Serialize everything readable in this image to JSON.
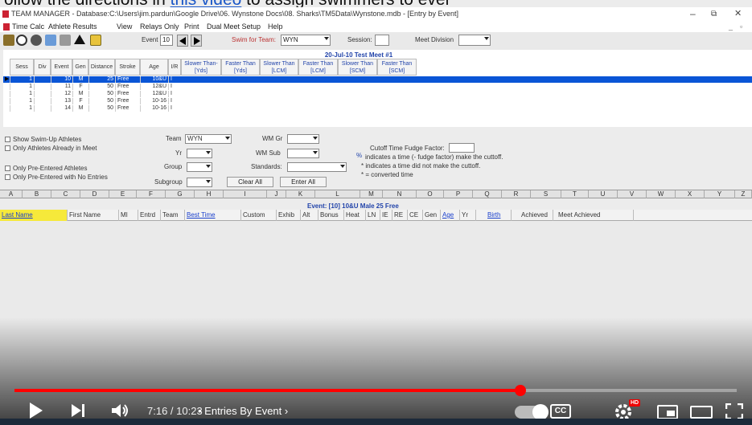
{
  "caption": {
    "before": "ollow the directions in ",
    "link": "this video",
    "after": " to assign swimmers to ever"
  },
  "window": {
    "title": "TEAM MANAGER - Database:C:\\Users\\jim.pardun\\Google Drive\\06. Wynstone Docs\\08. Sharks\\TM5Data\\Wynstone.mdb - [Entry by Event]",
    "minimize": "–",
    "restore": "⧉",
    "close": "✕"
  },
  "menu": [
    "Time Calc",
    "Athlete Results",
    "View",
    "Relays Only",
    "Print",
    "Dual Meet Setup",
    "Help"
  ],
  "toolbar": {
    "event_label": "Event",
    "event_value": "10",
    "swim_for_team_label": "Swim for Team:",
    "swim_for_team_value": "WYN",
    "session_label": "Session:",
    "session_value": "",
    "meet_division_label": "Meet Division",
    "meet_division_value": ""
  },
  "meet_banner": "20-Jul-10  Test Meet #1",
  "event_grid": {
    "headers": [
      "Sess",
      "Div",
      "Event",
      "Gen",
      "Distance",
      "Stroke",
      "Age",
      "I/R",
      "Slower Than-[Yds]",
      "Faster Than [Yds]",
      "Slower Than [LCM]",
      "Faster Than [LCM]",
      "Slower Than [SCM]",
      "Faster Than [SCM]"
    ],
    "rows": [
      {
        "sess": "1",
        "div": "",
        "event": "10",
        "gen": "M",
        "distance": "25",
        "stroke": "Free",
        "age": "10&U",
        "ir": "I"
      },
      {
        "sess": "1",
        "div": "",
        "event": "11",
        "gen": "F",
        "distance": "50",
        "stroke": "Free",
        "age": "12&U",
        "ir": "I"
      },
      {
        "sess": "1",
        "div": "",
        "event": "12",
        "gen": "M",
        "distance": "50",
        "stroke": "Free",
        "age": "12&U",
        "ir": "I"
      },
      {
        "sess": "1",
        "div": "",
        "event": "13",
        "gen": "F",
        "distance": "50",
        "stroke": "Free",
        "age": "10-16",
        "ir": "I"
      },
      {
        "sess": "1",
        "div": "",
        "event": "14",
        "gen": "M",
        "distance": "50",
        "stroke": "Free",
        "age": "10-16",
        "ir": "I"
      }
    ]
  },
  "filters": {
    "show_swim_up": "Show Swim-Up Athletes",
    "only_in_meet": "Only Athletes Already in Meet",
    "only_pre_entered": "Only Pre-Entered Athletes",
    "pre_entered_no_entries": "Only Pre-Entered with No Entries",
    "team_label": "Team",
    "team_value": "WYN",
    "yr_label": "Yr",
    "group_label": "Group",
    "subgroup_label": "Subgroup",
    "wm_gr_label": "WM Gr",
    "wm_sub_label": "WM Sub",
    "standards_label": "Standards:",
    "clear_all": "Clear All",
    "enter_all": "Enter All",
    "fudge_label": "Cutoff Time Fudge Factor:",
    "legend_pct_sym": "%",
    "legend_pct": "indicates a time (- fudge factor) make the cuttoff.",
    "legend_star": "*  indicates a time did not make the cuttoff.",
    "legend_dot": "*  = converted time"
  },
  "column_letters": [
    "A",
    "B",
    "C",
    "D",
    "E",
    "F",
    "G",
    "H",
    "I",
    "J",
    "K",
    "L",
    "M",
    "N",
    "O",
    "P",
    "Q",
    "R",
    "S",
    "T",
    "U",
    "V",
    "W",
    "X",
    "Y",
    "Z"
  ],
  "event_header": "Event: [10]  10&U  Male  25  Free",
  "field_headers": [
    "Last Name",
    "First Name",
    "MI",
    "Entrd",
    "Team",
    "Best Time",
    "Custom",
    "Exhib",
    "Alt",
    "Bonus",
    "Heat",
    "LN",
    "IE",
    "RE",
    "CE",
    "Gen",
    "Age",
    "Yr",
    "Birth",
    "Achieved",
    "Meet Achieved"
  ],
  "player": {
    "time": "7:16 / 10:23",
    "chapter": "• Entries By Event ›",
    "progress": 0.7,
    "cc": "CC",
    "hd": "HD"
  },
  "colors": {
    "accent": "#ff0000",
    "selected_row": "#0a55d6",
    "highlight": "#f6e93a"
  }
}
